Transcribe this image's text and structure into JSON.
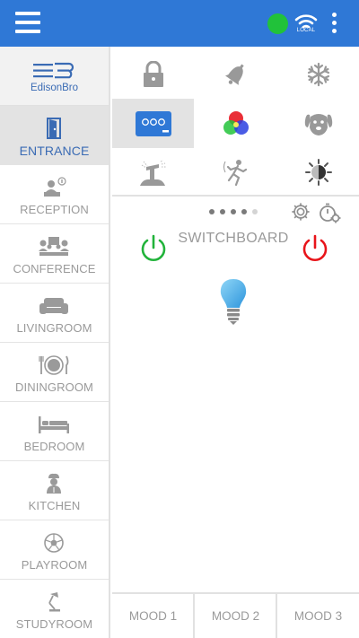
{
  "topbar": {
    "menu_icon": "hamburger-menu-icon",
    "status_color": "#21c23a",
    "connection_label": "LOCAL",
    "more_icon": "vertical-dots-icon",
    "bar_color": "#2f78d6"
  },
  "brand": {
    "name": "EdisonBro"
  },
  "sidebar": {
    "rooms": [
      {
        "label": "ENTRANCE",
        "icon": "door-icon",
        "active": true
      },
      {
        "label": "RECEPTION",
        "icon": "reception-desk-icon"
      },
      {
        "label": "CONFERENCE",
        "icon": "conference-icon"
      },
      {
        "label": "LIVINGROOM",
        "icon": "sofa-icon"
      },
      {
        "label": "DININGROOM",
        "icon": "dining-plate-icon"
      },
      {
        "label": "BEDROOM",
        "icon": "bed-icon"
      },
      {
        "label": "KITCHEN",
        "icon": "chef-icon"
      },
      {
        "label": "PLAYROOM",
        "icon": "soccer-ball-icon"
      },
      {
        "label": "STUDYROOM",
        "icon": "desk-lamp-icon"
      }
    ],
    "active_color": "#3a6bb4"
  },
  "device_grid": [
    {
      "icon": "lock-icon"
    },
    {
      "icon": "bell-icon"
    },
    {
      "icon": "snowflake-icon"
    },
    {
      "icon": "switchboard-icon",
      "selected": true
    },
    {
      "icon": "rgb-color-icon"
    },
    {
      "icon": "dog-icon"
    },
    {
      "icon": "sprinkler-icon"
    },
    {
      "icon": "motion-sensor-icon"
    },
    {
      "icon": "dimmer-icon"
    }
  ],
  "panel": {
    "title": "SWITCHBOARD",
    "page_dots": 4,
    "active_page": 1,
    "on_color": "#21b33a",
    "off_color": "#e8141a",
    "bulb_color": "#4fb6ec"
  },
  "moods": [
    {
      "label": "MOOD 1"
    },
    {
      "label": "MOOD 2"
    },
    {
      "label": "MOOD 3"
    }
  ]
}
